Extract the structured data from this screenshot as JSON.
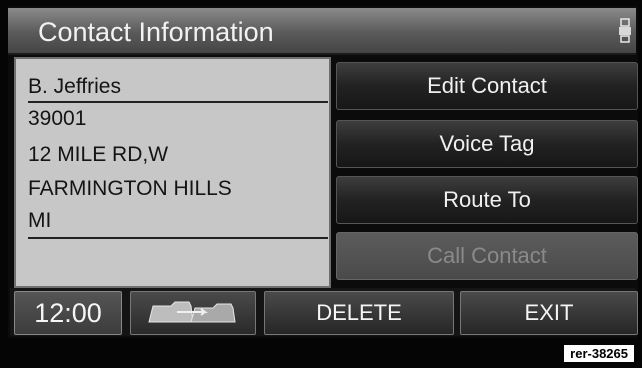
{
  "header": {
    "title": "Contact Information",
    "icon": "printer-icon"
  },
  "contact": {
    "name": "B. Jeffries",
    "address_lines": [
      "39001",
      "12 MILE RD,W",
      "FARMINGTON HILLS",
      "MI"
    ]
  },
  "menu": {
    "buttons": [
      {
        "label": "Edit Contact",
        "enabled": true
      },
      {
        "label": "Voice Tag",
        "enabled": true
      },
      {
        "label": "Route To",
        "enabled": true
      },
      {
        "label": "Call Contact",
        "enabled": false
      }
    ]
  },
  "bottom_bar": {
    "clock": "12:00",
    "folder_icon": "folder-transfer-icon",
    "delete_label": "DELETE",
    "exit_label": "EXIT"
  },
  "reference_label": "rer-38265",
  "colors": {
    "panel_bg": "#c7c7c7",
    "title_bar": "#6e6e6e",
    "button_bg": "#222222",
    "disabled_text": "#8a8a8a"
  }
}
